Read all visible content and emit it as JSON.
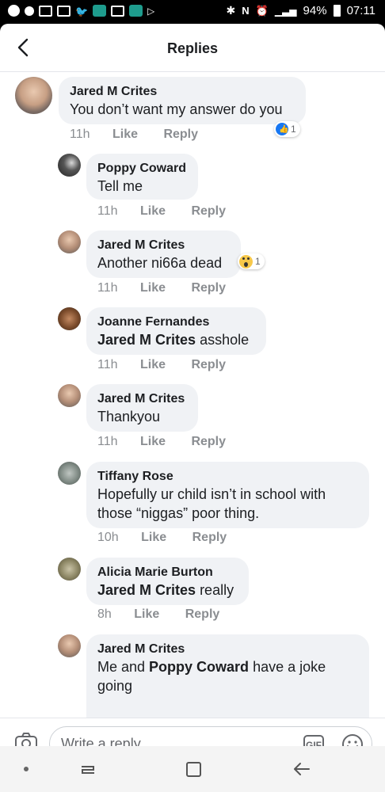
{
  "status_bar": {
    "battery": "94%",
    "time": "07:11"
  },
  "header": {
    "title": "Replies"
  },
  "comments": [
    {
      "name": "Jared M Crites",
      "text": "You don’t want my answer do you",
      "time": "11h",
      "like": "Like",
      "reply": "Reply",
      "reaction_count": "1"
    },
    {
      "name": "Poppy Coward",
      "text": "Tell me",
      "time": "11h",
      "like": "Like",
      "reply": "Reply"
    },
    {
      "name": "Jared M Crites",
      "text": "Another ni66a dead",
      "time": "11h",
      "like": "Like",
      "reply": "Reply",
      "reaction_count": "1"
    },
    {
      "name": "Joanne Fernandes",
      "mention": "Jared M Crites",
      "text": " asshole",
      "time": "11h",
      "like": "Like",
      "reply": "Reply"
    },
    {
      "name": "Jared M Crites",
      "text": "Thankyou",
      "time": "11h",
      "like": "Like",
      "reply": "Reply"
    },
    {
      "name": "Tiffany Rose",
      "text_line1": "Hopefully ur child isn’t in school with",
      "text_line2": "those “niggas” poor thing.",
      "time": "10h",
      "like": "Like",
      "reply": "Reply"
    },
    {
      "name": "Alicia Marie Burton",
      "mention": "Jared M Crites",
      "text": " really",
      "time": "8h",
      "like": "Like",
      "reply": "Reply"
    },
    {
      "name": "Jared M Crites",
      "text_pre": "Me and ",
      "mention": "Poppy Coward",
      "text_post": " have a joke",
      "text_line2": "going"
    }
  ],
  "composer": {
    "placeholder": "Write a reply...",
    "gif_label": "GIF"
  },
  "icons": {
    "back": "back-arrow-icon",
    "camera": "camera-icon",
    "emoji": "smile-icon"
  },
  "colors": {
    "accent": "#1877f2",
    "bubble": "#f0f2f5",
    "meta": "#8a8d91"
  }
}
